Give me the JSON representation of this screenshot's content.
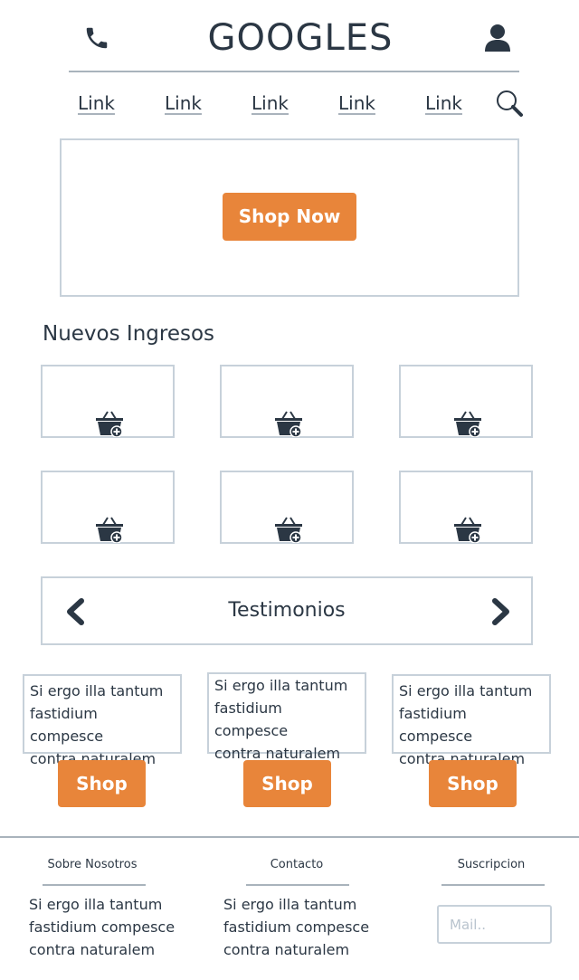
{
  "header": {
    "brand": "GOOGLES",
    "phone_icon": "phone-icon",
    "user_icon": "user-icon"
  },
  "nav": {
    "links": [
      "Link",
      "Link",
      "Link",
      "Link",
      "Link"
    ],
    "search_icon": "search-icon"
  },
  "hero": {
    "button_label": "Shop Now"
  },
  "new_arrivals": {
    "title": "Nuevos Ingresos",
    "product_icon": "basket-add-icon"
  },
  "testimonials": {
    "title": "Testimonios",
    "prev_icon": "chevron-left-icon",
    "next_icon": "chevron-right-icon",
    "items": [
      {
        "text_lines": [
          "Si ergo illa tantum",
          "fastidium compesce",
          "contra naturalem"
        ],
        "button_label": "Shop"
      },
      {
        "text_lines": [
          "Si ergo illa tantum",
          "fastidium compesce",
          "contra naturalem"
        ],
        "button_label": "Shop"
      },
      {
        "text_lines": [
          "Si ergo illa tantum",
          "fastidium compesce",
          "contra naturalem"
        ],
        "button_label": "Shop"
      }
    ]
  },
  "footer": {
    "about": {
      "title": "Sobre Nosotros",
      "lines": [
        "Si ergo illa tantum",
        "fastidium compesce",
        "contra naturalem"
      ]
    },
    "contact": {
      "title": "Contacto",
      "lines": [
        "Si ergo illa tantum",
        "fastidium compesce",
        "contra naturalem"
      ]
    },
    "subscription": {
      "title": "Suscripcion",
      "placeholder": "Mail.."
    }
  },
  "colors": {
    "accent": "#e8853a",
    "text": "#2b3744",
    "border": "#c7d1da",
    "rule": "#a9b3bc"
  }
}
